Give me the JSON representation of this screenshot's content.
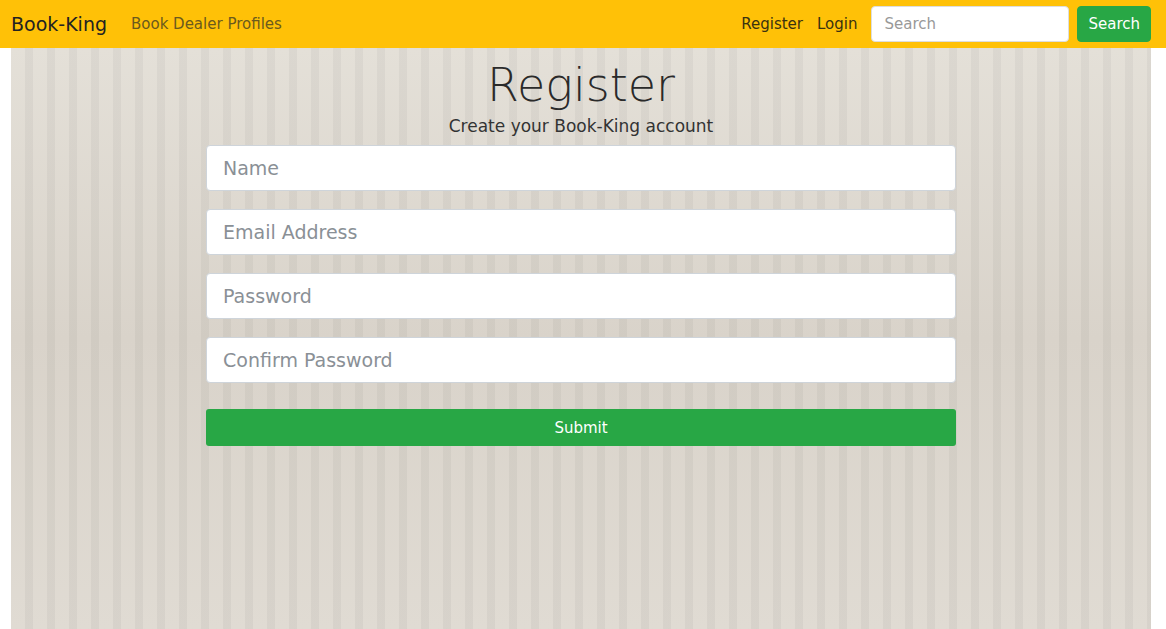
{
  "navbar": {
    "brand": "Book-King",
    "links": [
      "Book Dealer Profiles"
    ],
    "right_links": [
      "Register",
      "Login"
    ],
    "search": {
      "placeholder": "Search",
      "button": "Search"
    }
  },
  "form": {
    "title": "Register",
    "subtitle": "Create your Book-King account",
    "fields": [
      {
        "placeholder": "Name"
      },
      {
        "placeholder": "Email Address"
      },
      {
        "placeholder": "Password"
      },
      {
        "placeholder": "Confirm Password"
      }
    ],
    "submit": "Submit"
  }
}
